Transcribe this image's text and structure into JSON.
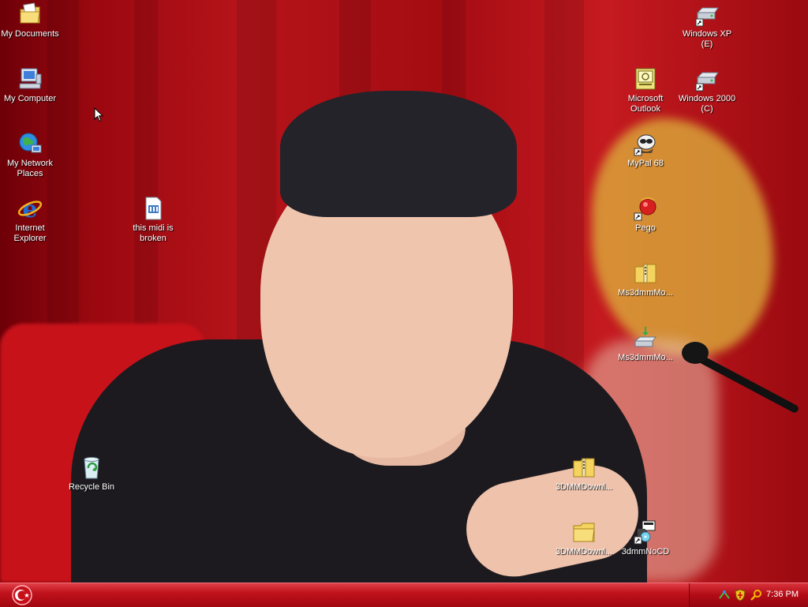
{
  "desktop": {
    "icons_left": [
      {
        "name": "my-documents-icon",
        "label": "My Documents"
      },
      {
        "name": "my-computer-icon",
        "label": "My Computer"
      },
      {
        "name": "my-network-places-icon",
        "label": "My Network\nPlaces"
      },
      {
        "name": "internet-explorer-icon",
        "label": "Internet\nExplorer"
      },
      {
        "name": "midi-file-icon",
        "label": "this midi is\nbroken"
      },
      {
        "name": "recycle-bin-icon",
        "label": "Recycle Bin"
      }
    ],
    "icons_right": [
      {
        "name": "windows-xp-drive-icon",
        "label": "Windows XP\n(E)"
      },
      {
        "name": "microsoft-outlook-icon",
        "label": "Microsoft\nOutlook"
      },
      {
        "name": "windows-2000-drive-icon",
        "label": "Windows 2000\n(C)"
      },
      {
        "name": "mypal-icon",
        "label": "MyPal 68"
      },
      {
        "name": "pego-icon",
        "label": "Pego"
      },
      {
        "name": "zip-folder-icon",
        "label": "Ms3dmmMo..."
      },
      {
        "name": "installer-icon",
        "label": "Ms3dmmMo..."
      },
      {
        "name": "zip-folder-icon",
        "label": "3DMMDownl..."
      },
      {
        "name": "folder-icon",
        "label": "3DMMDownl..."
      },
      {
        "name": "app-icon",
        "label": "3dmmNoCD"
      }
    ]
  },
  "taskbar": {
    "start_icon": "crescent-star-icon",
    "tray_icons": [
      "keyboard-icon",
      "network-icon",
      "shield-icon",
      "search-icon"
    ],
    "clock": "7:36 PM"
  },
  "colors": {
    "taskbar": "#c0121c",
    "icon_text": "#ffffff"
  }
}
